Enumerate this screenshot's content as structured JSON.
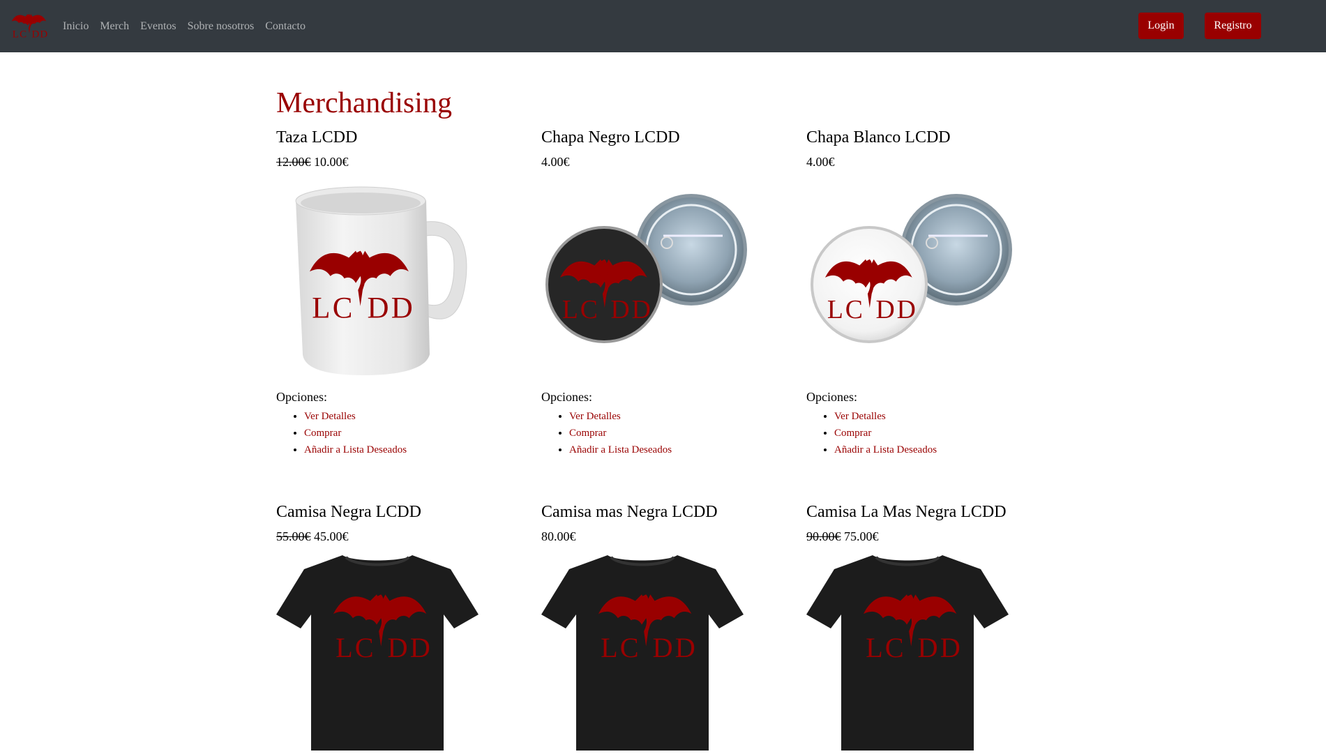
{
  "nav": {
    "brand_text": "LCDD",
    "links": [
      "Inicio",
      "Merch",
      "Eventos",
      "Sobre nosotros",
      "Contacto"
    ],
    "login_label": "Login",
    "register_label": "Registro"
  },
  "colors": {
    "accent": "#990000",
    "navbar": "#343a40"
  },
  "main": {
    "title": "Merchandising",
    "options_label": "Opciones:",
    "option_links": [
      "Ver Detalles",
      "Comprar",
      "Añadir a Lista Deseados"
    ],
    "products": [
      {
        "name": "Taza LCDD",
        "old_price": "12.00€",
        "price": "10.00€",
        "image": "mug"
      },
      {
        "name": "Chapa Negro LCDD",
        "old_price": "",
        "price": "4.00€",
        "image": "badge-black"
      },
      {
        "name": "Chapa Blanco LCDD",
        "old_price": "",
        "price": "4.00€",
        "image": "badge-white"
      },
      {
        "name": "Camisa Negra LCDD",
        "old_price": "55.00€",
        "price": "45.00€",
        "image": "tshirt"
      },
      {
        "name": "Camisa mas Negra LCDD",
        "old_price": "",
        "price": "80.00€",
        "image": "tshirt"
      },
      {
        "name": "Camisa La Mas Negra LCDD",
        "old_price": "90.00€",
        "price": "75.00€",
        "image": "tshirt"
      }
    ]
  }
}
